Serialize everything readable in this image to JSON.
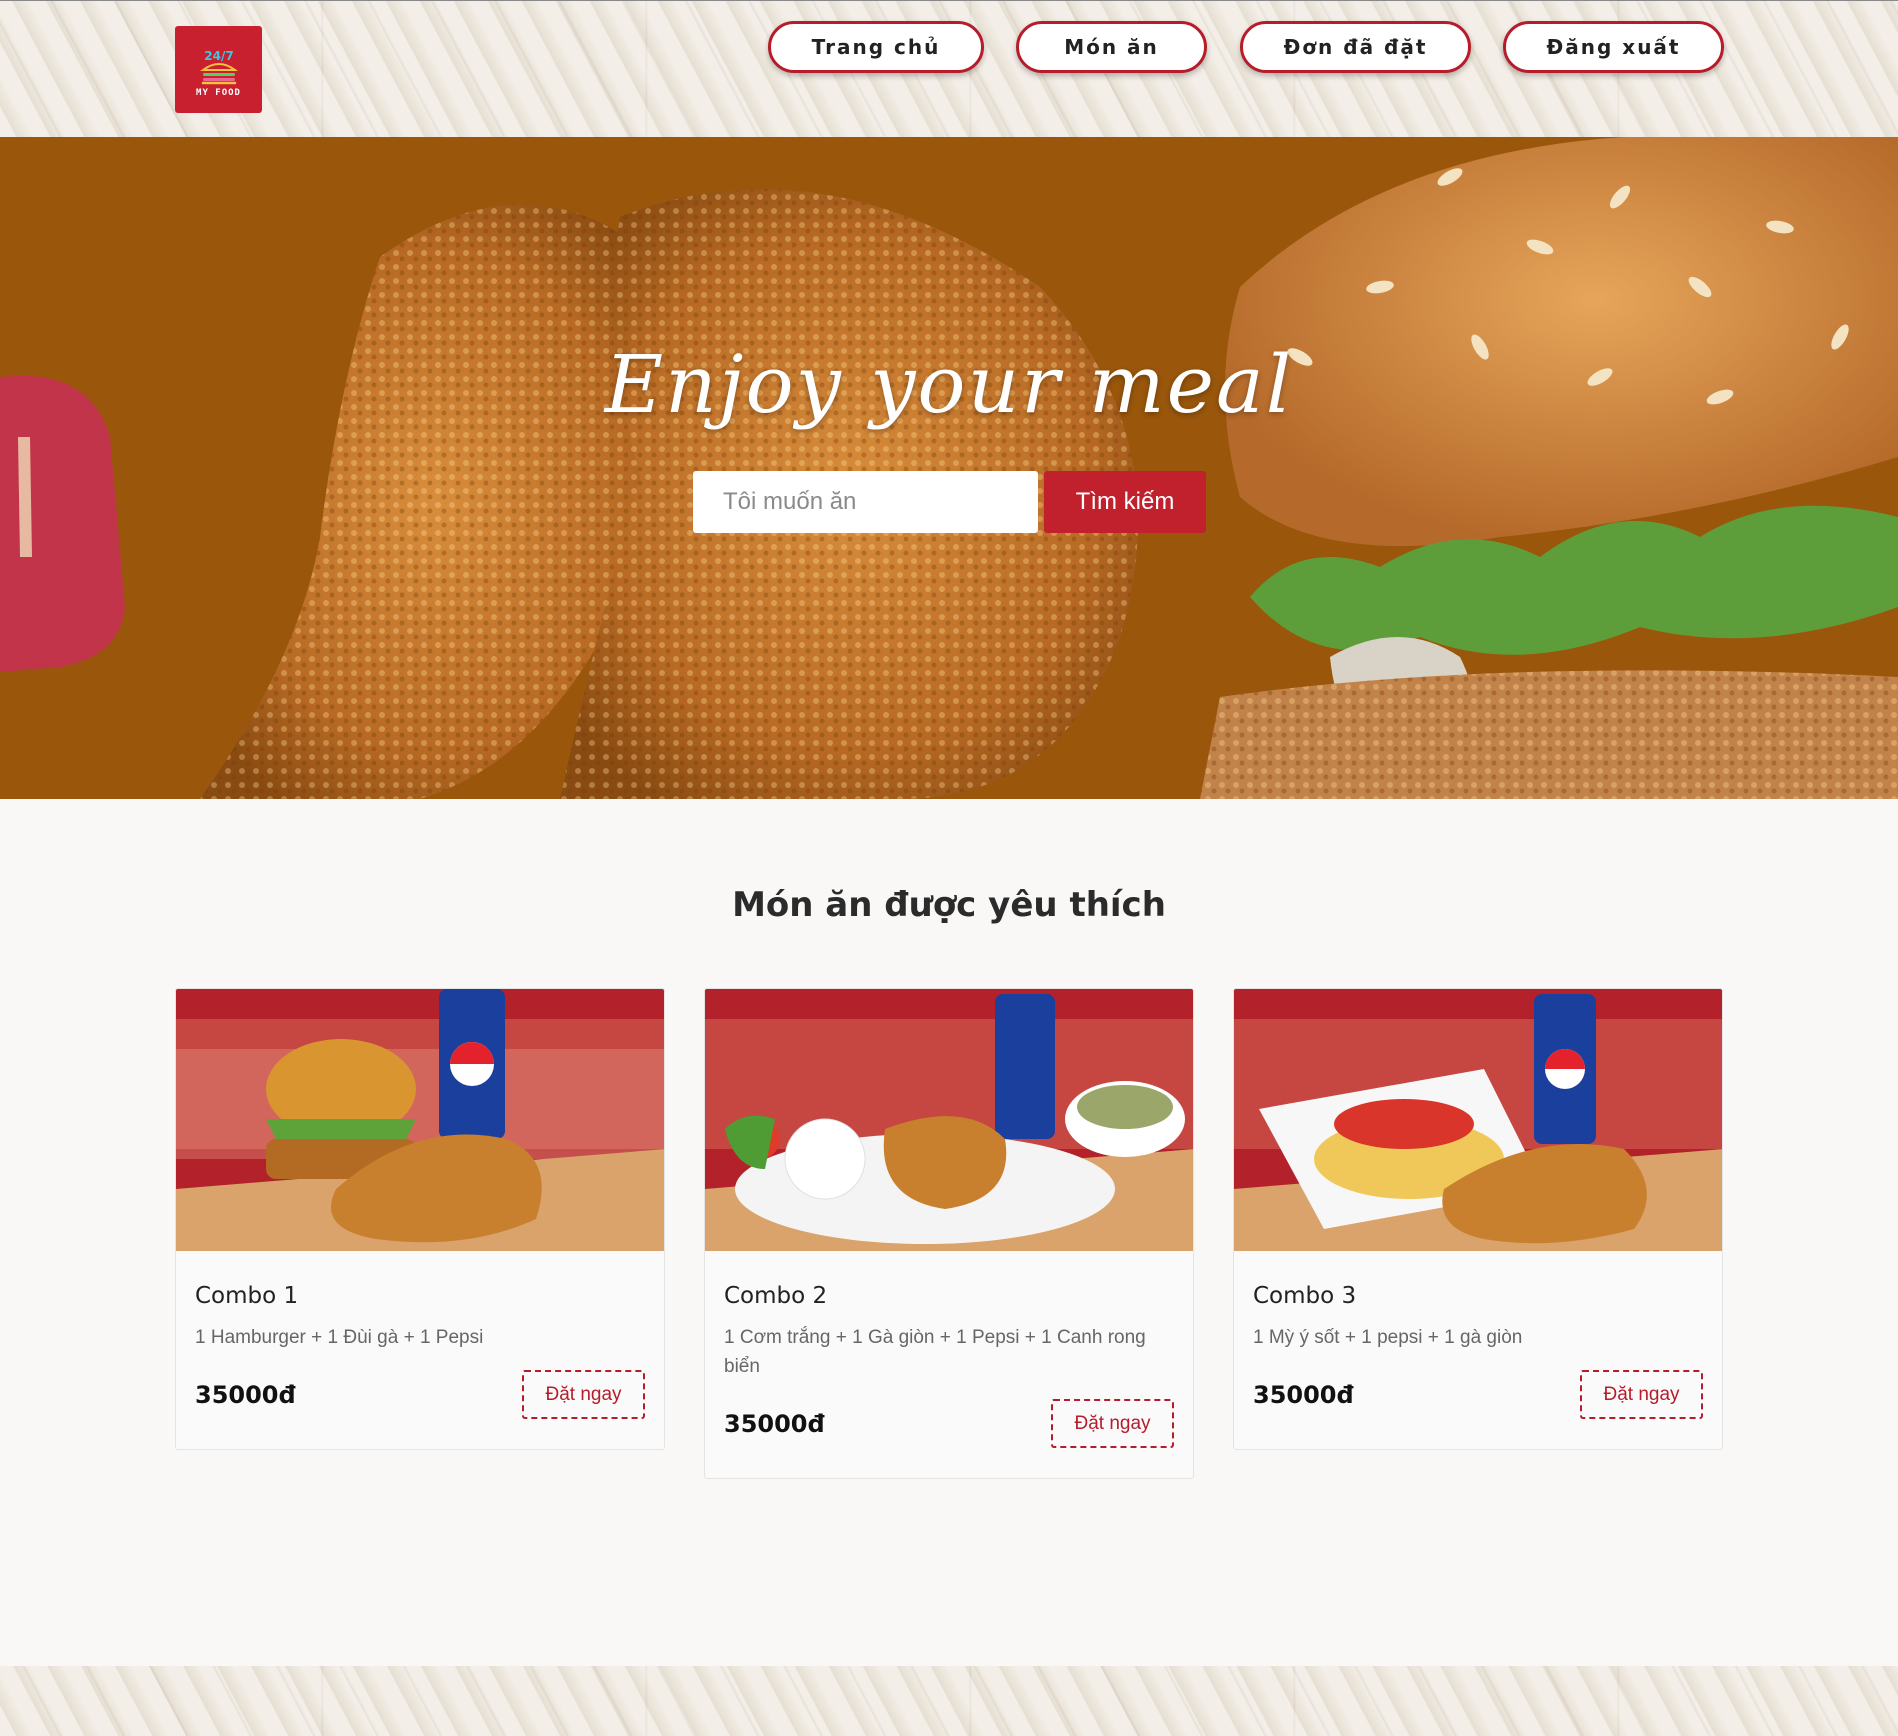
{
  "logo": {
    "text": "MY FOOD",
    "badge": "24/7"
  },
  "nav": [
    {
      "label": "Trang chủ"
    },
    {
      "label": "Món ăn"
    },
    {
      "label": "Đơn đã đặt"
    },
    {
      "label": "Đăng xuất"
    }
  ],
  "hero": {
    "title": "Enjoy your meal",
    "search_placeholder": "Tôi muốn ăn",
    "search_button": "Tìm kiếm"
  },
  "favorites": {
    "title": "Món ăn được yêu thích",
    "order_label": "Đặt ngay",
    "items": [
      {
        "name": "Combo 1",
        "desc": "1 Hamburger + 1 Đùi gà + 1 Pepsi",
        "price": "35000đ"
      },
      {
        "name": "Combo 2",
        "desc": "1 Cơm trắng + 1 Gà giòn + 1 Pepsi + 1 Canh rong biển",
        "price": "35000đ"
      },
      {
        "name": "Combo 3",
        "desc": "1 Mỳ ý sốt + 1 pepsi + 1 gà giòn",
        "price": "35000đ"
      }
    ]
  },
  "colors": {
    "brand": "#c0212c",
    "hero_bg": "#9a570c",
    "page_bg": "#f9f8f6"
  }
}
